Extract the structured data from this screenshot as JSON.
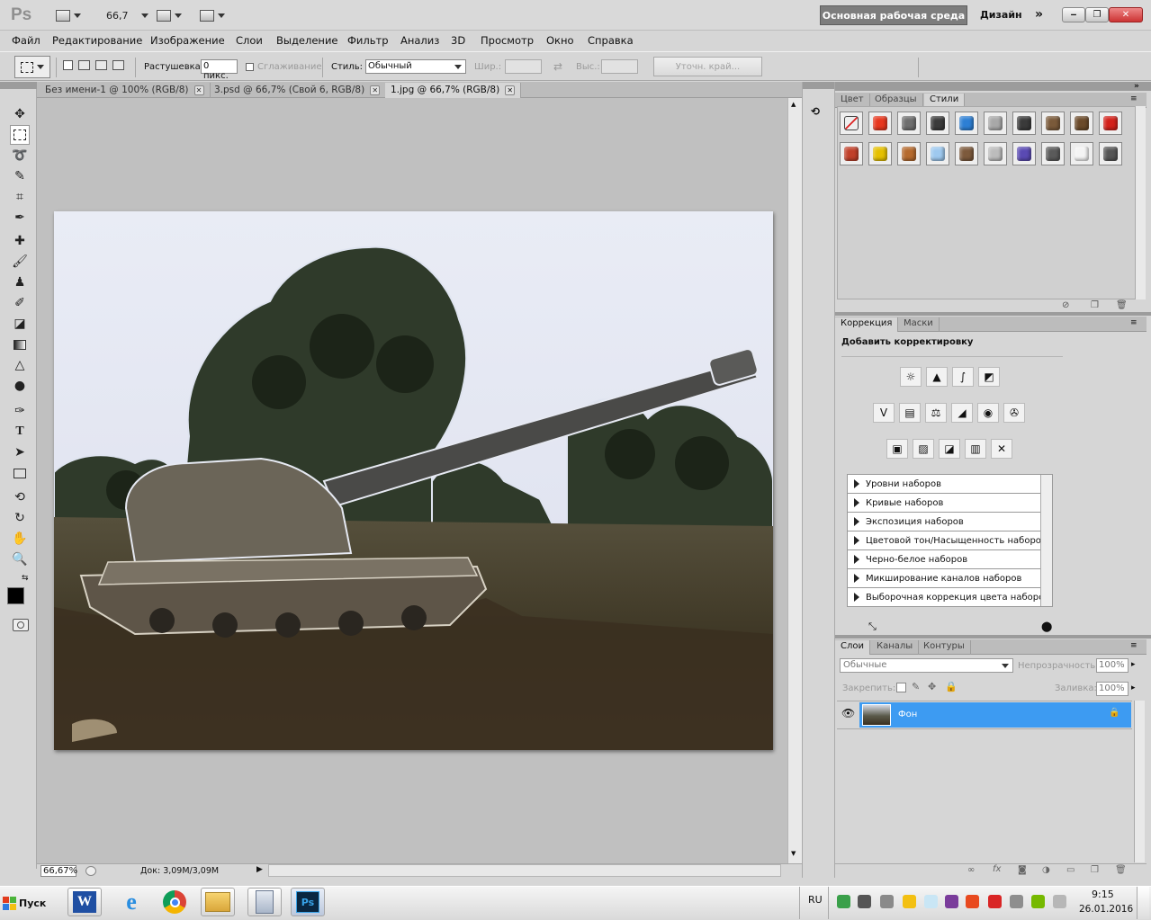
{
  "app": {
    "logo": "Ps"
  },
  "titlebar": {
    "zoom": "66,7",
    "workspace_active": "Основная рабочая среда",
    "workspace_design": "Дизайн",
    "more": "»"
  },
  "menu": [
    "Файл",
    "Редактирование",
    "Изображение",
    "Слои",
    "Выделение",
    "Фильтр",
    "Анализ",
    "3D",
    "Просмотр",
    "Окно",
    "Справка"
  ],
  "options": {
    "feather_label": "Растушевка:",
    "feather_value": "0 пикс.",
    "antialias_label": "Сглаживание",
    "style_label": "Стиль:",
    "style_value": "Обычный",
    "width_label": "Шир.:",
    "height_label": "Выс.:",
    "refine_button": "Уточн. край..."
  },
  "tabs": [
    {
      "label": "Без имени-1 @ 100% (RGB/8)",
      "active": false
    },
    {
      "label": "3.psd @ 66,7% (Свой 6, RGB/8)",
      "active": false
    },
    {
      "label": "1.jpg @ 66,7% (RGB/8)",
      "active": true
    }
  ],
  "status": {
    "zoom": "66,67%",
    "doc": "Док: 3,09M/3,09M"
  },
  "panels": {
    "top_tabs": [
      "Цвет",
      "Образцы",
      "Стили"
    ],
    "adjust_tabs": [
      "Коррекция",
      "Маски"
    ],
    "adjust_title": "Добавить корректировку",
    "presets": [
      "Уровни наборов",
      "Кривые наборов",
      "Экспозиция наборов",
      "Цветовой тон/Насыщенность наборов",
      "Черно-белое наборов",
      "Микширование каналов наборов",
      "Выборочная коррекция цвета наборов"
    ],
    "layer_tabs": [
      "Слои",
      "Каналы",
      "Контуры"
    ],
    "blend_mode": "Обычные",
    "opacity_label": "Непрозрачность:",
    "opacity_value": "100%",
    "lock_label": "Закрепить:",
    "fill_label": "Заливка:",
    "fill_value": "100%",
    "layer_name": "Фон"
  },
  "style_swatches": [
    "#ffffff",
    "#e7361d",
    "#6e6e6e",
    "#3b3b3b",
    "#2d7fd4",
    "#a8a8a8",
    "#3a3a3a",
    "#7a5a3a",
    "#6b4a2a",
    "#d2201a",
    "#c0402a",
    "#e5c000",
    "#b56a2e",
    "#9ec9ef",
    "#7d5a3c",
    "#bcbcbc",
    "#5a4ab3",
    "#5a5a5a",
    "#f4f4f4",
    "#555555"
  ],
  "taskbar": {
    "start": "Пуск",
    "lang": "RU",
    "time": "9:15",
    "date": "26.01.2016"
  }
}
